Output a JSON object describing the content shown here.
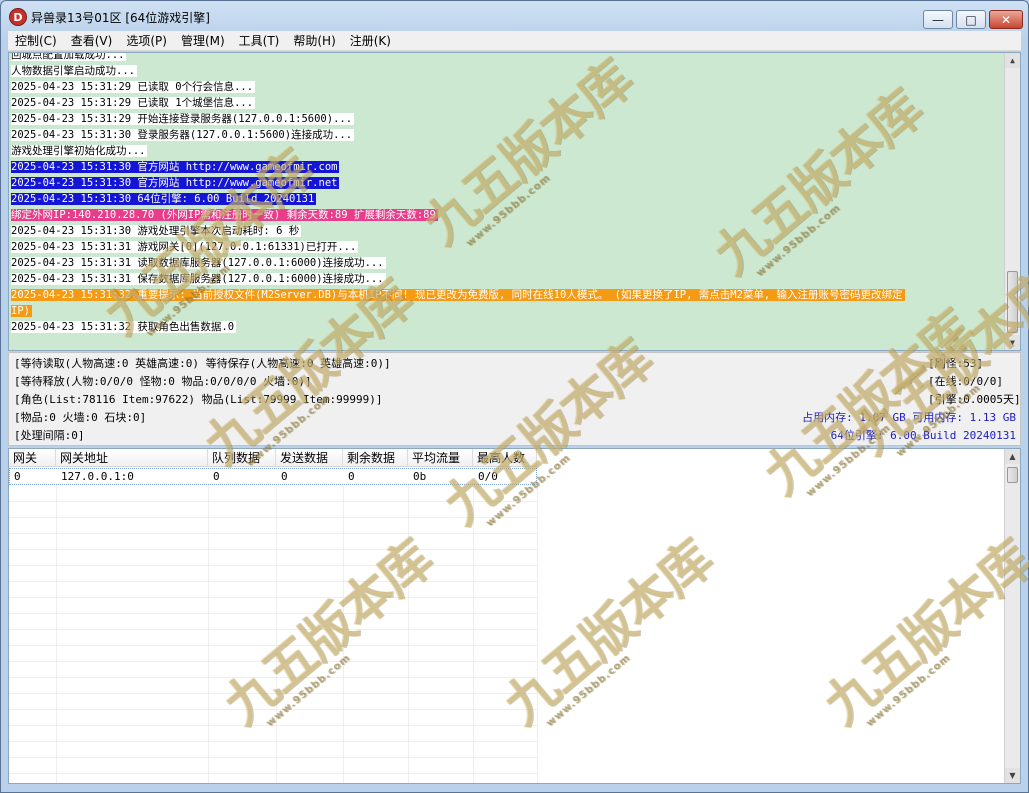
{
  "window": {
    "title": "异兽录13号01区 [64位游戏引擎]",
    "icon_letter": "D",
    "controls": {
      "minimize": "—",
      "restore": "□",
      "close": "✕"
    }
  },
  "menu": [
    "控制(C)",
    "查看(V)",
    "选项(P)",
    "管理(M)",
    "工具(T)",
    "帮助(H)",
    "注册(K)"
  ],
  "log": {
    "lines": [
      {
        "text": "回城点配置加载成功...",
        "style": "hl-white"
      },
      {
        "text": "人物数据引擎启动成功...",
        "style": "hl-white"
      },
      {
        "text": "2025-04-23 15:31:29 已读取 0个行会信息...",
        "style": "hl-white"
      },
      {
        "text": "2025-04-23 15:31:29 已读取 1个城堡信息...",
        "style": "hl-white"
      },
      {
        "text": "2025-04-23 15:31:29 开始连接登录服务器(127.0.0.1:5600)...",
        "style": "hl-white"
      },
      {
        "text": "2025-04-23 15:31:30 登录服务器(127.0.0.1:5600)连接成功...",
        "style": "hl-white"
      },
      {
        "text": "游戏处理引擎初始化成功...",
        "style": "hl-white"
      },
      {
        "text": "2025-04-23 15:31:30 官方网站 http://www.gameofmir.com",
        "style": "hl-blue"
      },
      {
        "text": "2025-04-23 15:31:30 官方网站 http://www.gameofmir.net",
        "style": "hl-blue"
      },
      {
        "text": "2025-04-23 15:31:30 64位引擎: 6.00 Build 20240131",
        "style": "hl-blue"
      },
      {
        "text": "绑定外网IP:140.210.28.70 (外网IP需和注册时一致) 剩余天数:89 扩展剩余天数:89",
        "style": "hl-pink"
      },
      {
        "text": "2025-04-23 15:31:30 游戏处理引擎本次启动耗时: 6 秒",
        "style": "hl-white"
      },
      {
        "text": "2025-04-23 15:31:31 游戏网关[0](127.0.0.1:61331)已打开...",
        "style": "hl-white"
      },
      {
        "text": "2025-04-23 15:31:31 读取数据库服务器(127.0.0.1:6000)连接成功...",
        "style": "hl-white"
      },
      {
        "text": "2025-04-23 15:31:31 保存数据库服务器(127.0.0.1:6000)连接成功...",
        "style": "hl-white"
      },
      {
        "text": "2025-04-23 15:31:32 重要提示: 当前授权文件(M2Server.DB)与本机IP不同! 现已更改为免费版, 同时在线10人模式。 (如果更换了IP, 需点击M2菜单, 输入注册账号密码更改绑定",
        "style": "hl-orange"
      },
      {
        "text": "IP)",
        "style": "hl-orange"
      },
      {
        "text": "2025-04-23 15:31:32 获取角色出售数据.0",
        "style": "hl-white"
      }
    ]
  },
  "status": {
    "waiting_read": "[等待读取(人物高速:0 英雄高速:0) 等待保存(人物高速:0 英雄高速:0)]",
    "refresh": "[刷怪:53]",
    "waiting_release": "[等待释放(人物:0/0/0 怪物:0 物品:0/0/0/0 火墙:0)]",
    "online": "[在线:0/0/0]",
    "role_list": "[角色(List:78116 Item:97622) 物品(List:79999 Item:99999)]",
    "engine": "[引擎:0.0005天]",
    "items": "[物品:0 火墙:0 石块:0]",
    "memory": "占用内存: 1.07 GB 可用内存: 1.13 GB",
    "interval": "[处理间隔:0]",
    "version": "64位引擎: 6.00 Build 20240131"
  },
  "grid": {
    "headers": [
      "网关",
      "网关地址",
      "队列数据",
      "发送数据",
      "剩余数据",
      "平均流量",
      "最高人数"
    ],
    "rows": [
      [
        "0",
        "127.0.0.1:0",
        "0",
        "0",
        "0",
        "0b",
        "0/0"
      ]
    ]
  },
  "watermark": {
    "title": "九五版本库",
    "url": "www.95bbb.com"
  }
}
